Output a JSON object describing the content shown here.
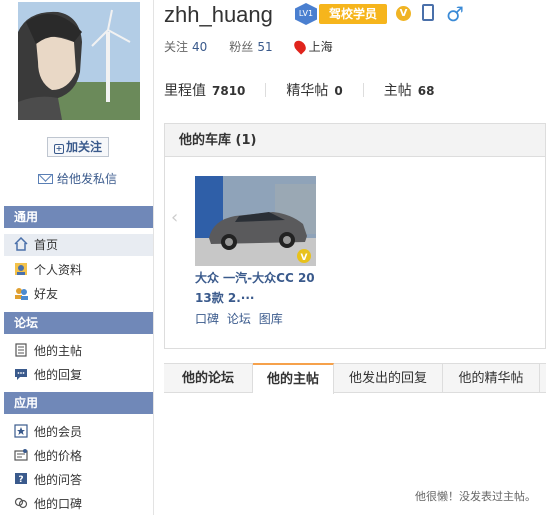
{
  "profile": {
    "username": "zhh_huang",
    "level": "LV1",
    "title_badge": "驾校学员",
    "follow_label": "关注",
    "follow_count": "40",
    "fans_label": "粉丝",
    "fans_count": "51",
    "location": "上海"
  },
  "scores": {
    "mileage_label": "里程值",
    "mileage_value": "7810",
    "essence_label": "精华帖",
    "essence_value": "0",
    "topics_label": "主帖",
    "topics_value": "68"
  },
  "sidebar": {
    "add_follow": "加关注",
    "send_message": "给他发私信",
    "sections": [
      {
        "title": "通用",
        "items": [
          "首页",
          "个人资料",
          "好友"
        ]
      },
      {
        "title": "论坛",
        "items": [
          "他的主帖",
          "他的回复"
        ]
      },
      {
        "title": "应用",
        "items": [
          "他的会员",
          "他的价格",
          "他的问答",
          "他的口碑"
        ]
      }
    ]
  },
  "garage": {
    "title": "他的车库 (1)",
    "car_name_line1": "大众 一汽-大众CC 20",
    "car_name_line2": "13款 2.···",
    "links": [
      "口碑",
      "论坛",
      "图库"
    ]
  },
  "tabs": {
    "section_label": "他的论坛",
    "items": [
      "他的主帖",
      "他发出的回复",
      "他的精华帖"
    ]
  },
  "empty_message": "他很懒！没发表过主帖。",
  "colors": {
    "accent": "#7088b8",
    "link": "#3a5a8c",
    "badge": "#f6b51c",
    "tab_active": "#f6a14b"
  }
}
